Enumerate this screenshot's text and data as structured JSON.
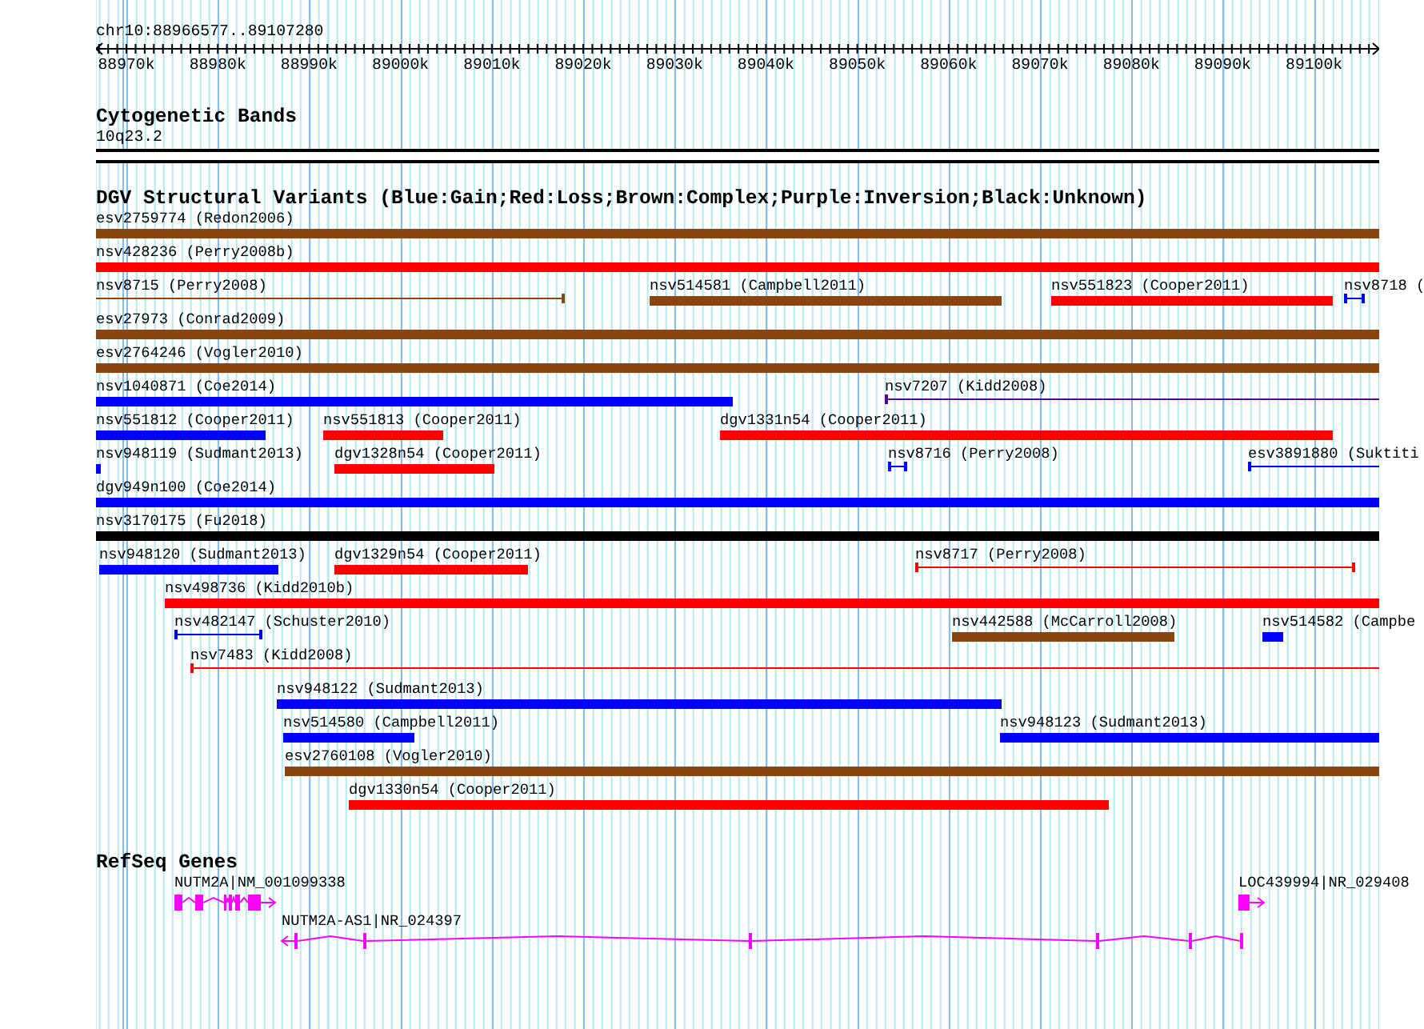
{
  "ruler": {
    "title": "chr10:88966577..89107280",
    "ticks": [
      "88970k",
      "88980k",
      "88990k",
      "89000k",
      "89010k",
      "89020k",
      "89030k",
      "89040k",
      "89050k",
      "89060k",
      "89070k",
      "89080k",
      "89090k",
      "89100k"
    ]
  },
  "cytogenetic_bands": {
    "title": "Cytogenetic Bands",
    "band": "10q23.2"
  },
  "dgv": {
    "title": "DGV Structural Variants (Blue:Gain;Red:Loss;Brown:Complex;Purple:Inversion;Black:Unknown)",
    "variants": [
      {
        "label": "esv2759774 (Redon2006)",
        "color": "#8b4513",
        "kind": "bar"
      },
      {
        "label": "nsv428236 (Perry2008b)",
        "color": "#ff0000",
        "kind": "bar"
      },
      {
        "label": "nsv8715 (Perry2008)",
        "color": "#8b4513",
        "kind": "line"
      },
      {
        "label": "nsv514581 (Campbell2011)",
        "color": "#8b4513",
        "kind": "bar"
      },
      {
        "label": "nsv551823 (Cooper2011)",
        "color": "#ff0000",
        "kind": "bar"
      },
      {
        "label": "nsv8718 (",
        "color": "#0000ff",
        "kind": "line"
      },
      {
        "label": "esv27973 (Conrad2009)",
        "color": "#8b4513",
        "kind": "bar"
      },
      {
        "label": "esv2764246 (Vogler2010)",
        "color": "#8b4513",
        "kind": "bar"
      },
      {
        "label": "nsv1040871 (Coe2014)",
        "color": "#0000ff",
        "kind": "bar"
      },
      {
        "label": "nsv7207 (Kidd2008)",
        "color": "#5a0090",
        "kind": "line"
      },
      {
        "label": "nsv551812 (Cooper2011)",
        "color": "#0000ff",
        "kind": "bar"
      },
      {
        "label": "nsv551813 (Cooper2011)",
        "color": "#ff0000",
        "kind": "bar"
      },
      {
        "label": "dgv1331n54 (Cooper2011)",
        "color": "#ff0000",
        "kind": "bar"
      },
      {
        "label": "nsv948119 (Sudmant2013)",
        "color": "#0000ff",
        "kind": "bar"
      },
      {
        "label": "dgv1328n54 (Cooper2011)",
        "color": "#ff0000",
        "kind": "bar"
      },
      {
        "label": "nsv8716 (Perry2008)",
        "color": "#0000ff",
        "kind": "line"
      },
      {
        "label": "esv3891880 (Suktiti",
        "color": "#0000ff",
        "kind": "line"
      },
      {
        "label": "dgv949n100 (Coe2014)",
        "color": "#0000ff",
        "kind": "bar"
      },
      {
        "label": "nsv3170175 (Fu2018)",
        "color": "#000000",
        "kind": "bar"
      },
      {
        "label": "nsv948120 (Sudmant2013)",
        "color": "#0000ff",
        "kind": "bar"
      },
      {
        "label": "dgv1329n54 (Cooper2011)",
        "color": "#ff0000",
        "kind": "bar"
      },
      {
        "label": "nsv8717 (Perry2008)",
        "color": "#ff0000",
        "kind": "line"
      },
      {
        "label": "nsv498736 (Kidd2010b)",
        "color": "#ff0000",
        "kind": "bar"
      },
      {
        "label": "nsv482147 (Schuster2010)",
        "color": "#0000ff",
        "kind": "line"
      },
      {
        "label": "nsv442588 (McCarroll2008)",
        "color": "#8b4513",
        "kind": "bar"
      },
      {
        "label": "nsv514582 (Campbe",
        "color": "#0000ff",
        "kind": "bar"
      },
      {
        "label": "nsv7483 (Kidd2008)",
        "color": "#ff0000",
        "kind": "line"
      },
      {
        "label": "nsv948122 (Sudmant2013)",
        "color": "#0000ff",
        "kind": "bar"
      },
      {
        "label": "nsv514580 (Campbell2011)",
        "color": "#0000ff",
        "kind": "bar"
      },
      {
        "label": "nsv948123 (Sudmant2013)",
        "color": "#0000ff",
        "kind": "bar"
      },
      {
        "label": "esv2760108 (Vogler2010)",
        "color": "#8b4513",
        "kind": "bar"
      },
      {
        "label": "dgv1330n54 (Cooper2011)",
        "color": "#ff0000",
        "kind": "bar"
      }
    ]
  },
  "refseq_genes": {
    "title": "RefSeq Genes",
    "genes": [
      {
        "label": "NUTM2A|NM_001099338"
      },
      {
        "label": "LOC439994|NR_029408"
      },
      {
        "label": "NUTM2A-AS1|NR_024397"
      }
    ]
  }
}
